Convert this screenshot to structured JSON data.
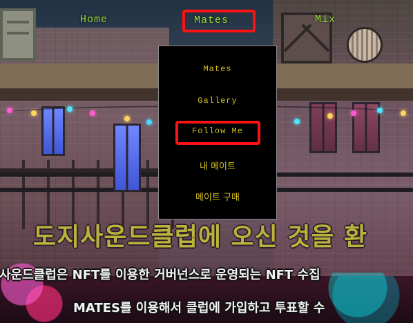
{
  "nav": {
    "items": [
      {
        "label": "Home"
      },
      {
        "label": "Mates"
      },
      {
        "label": "Mix"
      }
    ]
  },
  "dropdown": {
    "items": [
      {
        "label": "Mates"
      },
      {
        "label": "Gallery"
      },
      {
        "label": "Follow Me"
      },
      {
        "label": "내 메이트"
      },
      {
        "label": "메이트 구매"
      }
    ]
  },
  "hero": {
    "title": "도지사운드클럽에 오신 것을 환",
    "line_1": "사운드클럽은 NFT를 이용한 거버넌스로 운영되는 NFT 수집",
    "line_2": "MATES를 이용해서 클럽에 가입하고 투표할 수"
  },
  "colors": {
    "nav_text": "#9be43a",
    "dropdown_text": "#d6bf20",
    "highlight": "#ff1212",
    "title_text": "#bbb23c"
  },
  "icons": {
    "building": "building-scene",
    "vent": "vent-icon",
    "ac": "ac-unit-icon"
  }
}
